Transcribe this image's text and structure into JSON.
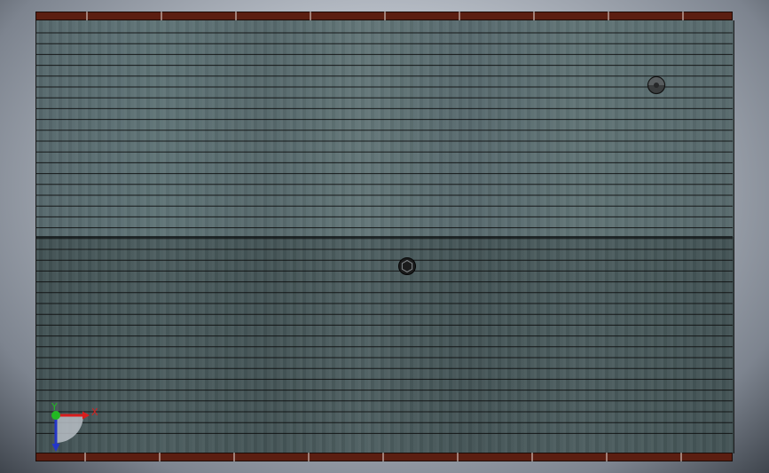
{
  "scene": {
    "colors": {
      "upper_surface": "#5a6c70",
      "lower_surface": "#465658",
      "frame_rail": "#5b1e11",
      "grid_line": "#0a0a0a",
      "background": "#b3b9c2"
    },
    "triad": {
      "x_label": "X",
      "y_label": "Y",
      "x_color": "#d81e1e",
      "y_color": "#22b822",
      "z_color": "#2436c8"
    },
    "markers": [
      {
        "name": "circular-marker-icon"
      },
      {
        "name": "hexagonal-marker-icon"
      }
    ]
  }
}
